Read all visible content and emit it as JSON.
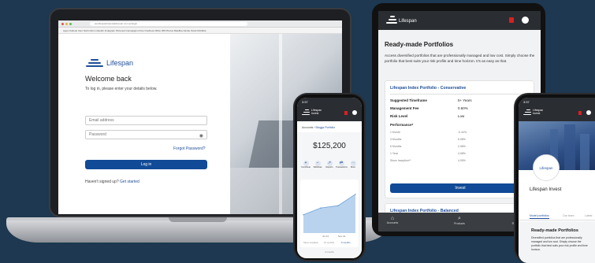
{
  "brand": {
    "accent": "#114a96",
    "dark_header": "#2a2d32",
    "alert_red": "#d92020"
  },
  "laptop": {
    "url": "ww.lifespanfinancialdomain.com.au/login",
    "bookmarks": "Apps  Outlook  Xero  Nab  Inbox  LinkedIn  Instagram  Pinterest  Campaigns  Drive  OneNote  Office 365  Photos  MapBox  Adobe  Stock  Dribbble",
    "logo_text": "Lifespan",
    "title": "Welcome back",
    "subtitle": "To log in, please enter your details below.",
    "email_placeholder": "Email address",
    "password_placeholder": "Password",
    "forgot": "Forgot Password?",
    "login_button": "Log in",
    "signup_prompt": "Haven't signed up?",
    "signup_link": "Get started"
  },
  "tablet": {
    "logo_text": "Lifespan",
    "title": "Ready-made Portfolios",
    "intro": "Access diversified portfolios that are professionally managed and low cost. Simply choose the portfolio that best suits your risk profile and time horizon. It's as easy as that.",
    "card1_title": "Lifespan Index Portfolio - Conservative",
    "rows": [
      {
        "label": "Suggested Timeframe",
        "value": "5+ Years"
      },
      {
        "label": "Management Fee",
        "value": "0.60%"
      },
      {
        "label": "Risk Level",
        "value": "Low"
      }
    ],
    "performance_label": "Performance*",
    "performance": [
      {
        "label": "1 Month",
        "value": "-0.44%"
      },
      {
        "label": "3 Months",
        "value": "6.08%"
      },
      {
        "label": "6 Months",
        "value": "2.98%"
      },
      {
        "label": "1 Year",
        "value": "4.98%"
      },
      {
        "label": "Since Inception**",
        "value": "4.05%"
      }
    ],
    "invest_button": "Invest",
    "card2_title": "Lifespan Index Portfolio - Balanced",
    "nav": [
      "Accounts",
      "Products",
      "Resources"
    ]
  },
  "phone1": {
    "time": "3:57",
    "logo_line1": "Lifespan",
    "logo_line2": "Invest",
    "breadcrumb_root": "Accounts",
    "breadcrumb_current": "Bloggs Portfolio",
    "balance": "$125,200",
    "actions": [
      "Contribute",
      "Withdraw",
      "Reports",
      "Transactions",
      "More"
    ],
    "x_ticks": [
      "Jul '21",
      "Nov '21"
    ],
    "ranges": [
      "Since inception",
      "12 months",
      "6 months"
    ],
    "range_extra": "3 months"
  },
  "phone2": {
    "time": "3:57",
    "logo_line1": "Lifespan",
    "logo_line2": "Invest",
    "badge_text": "Lifespan",
    "company": "Lifespan Invest",
    "tabs": [
      "Model portfolios",
      "Our team",
      "Latest"
    ],
    "section_title": "Ready-made Portfolios",
    "section_body": "Diversified portfolios that are professionally managed and low cost. Simply choose the portfolio that best suits your risk profile and time horizon."
  },
  "chart_data": {
    "type": "area",
    "x": [
      "",
      "Jul '21",
      "Nov '21",
      ""
    ],
    "series": [
      {
        "values": [
          40,
          55,
          60,
          85
        ]
      }
    ]
  }
}
